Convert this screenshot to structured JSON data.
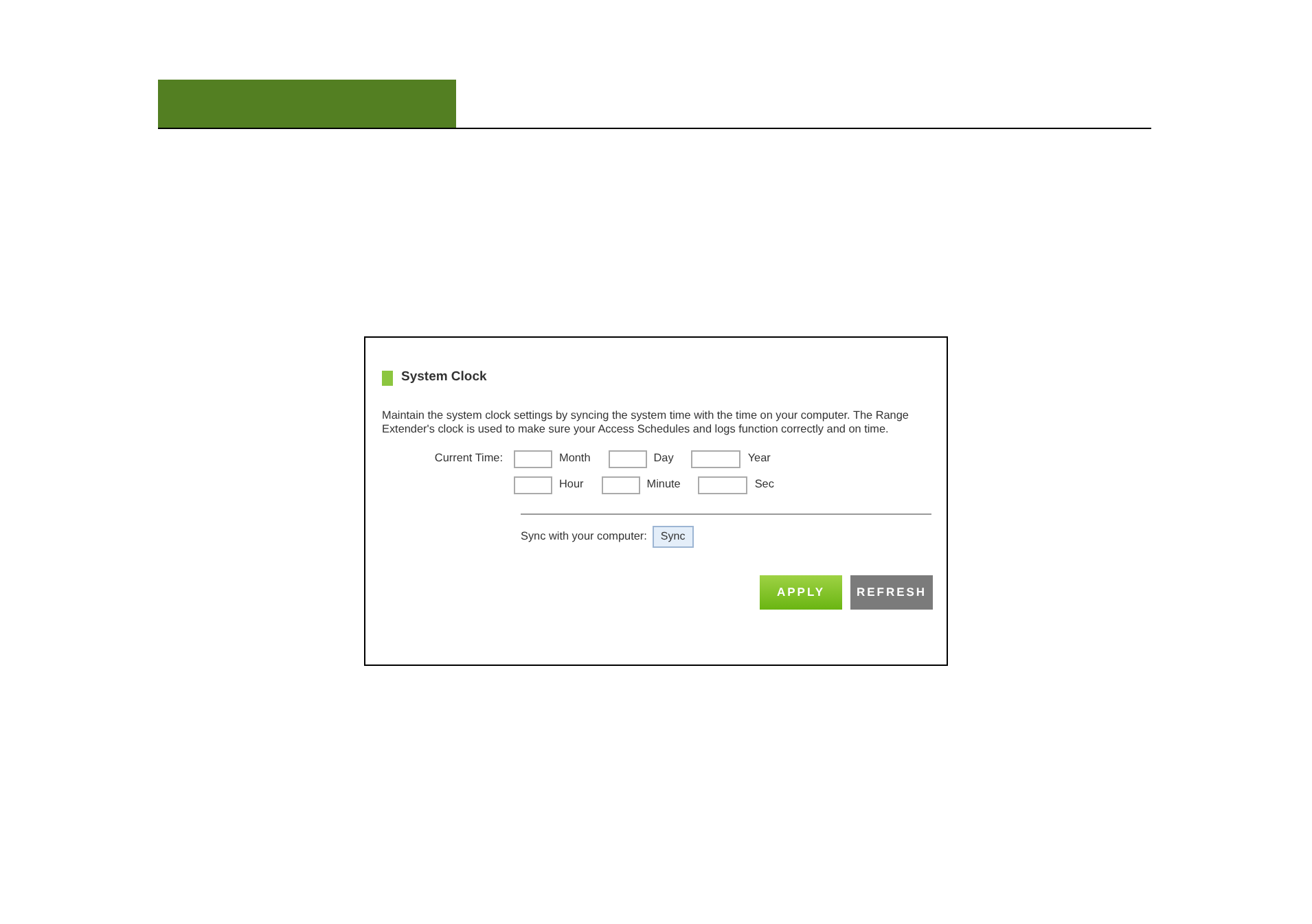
{
  "panel": {
    "title": "System Clock",
    "description": "Maintain the system clock settings by syncing the system time with the time on your computer. The Range Extender's clock is used to make sure your Access Schedules and logs function correctly and on time.",
    "current_time_label": "Current Time:",
    "time_fields": [
      [
        {
          "label": "Month"
        },
        {
          "label": "Day"
        },
        {
          "label": "Year"
        }
      ],
      [
        {
          "label": "Hour"
        },
        {
          "label": "Minute"
        },
        {
          "label": "Sec"
        }
      ]
    ],
    "sync_label": "Sync with your computer:",
    "sync_button": "Sync",
    "buttons": [
      {
        "label": "APPLY",
        "kind": "primary"
      },
      {
        "label": "REFRESH",
        "kind": "secondary"
      }
    ]
  }
}
